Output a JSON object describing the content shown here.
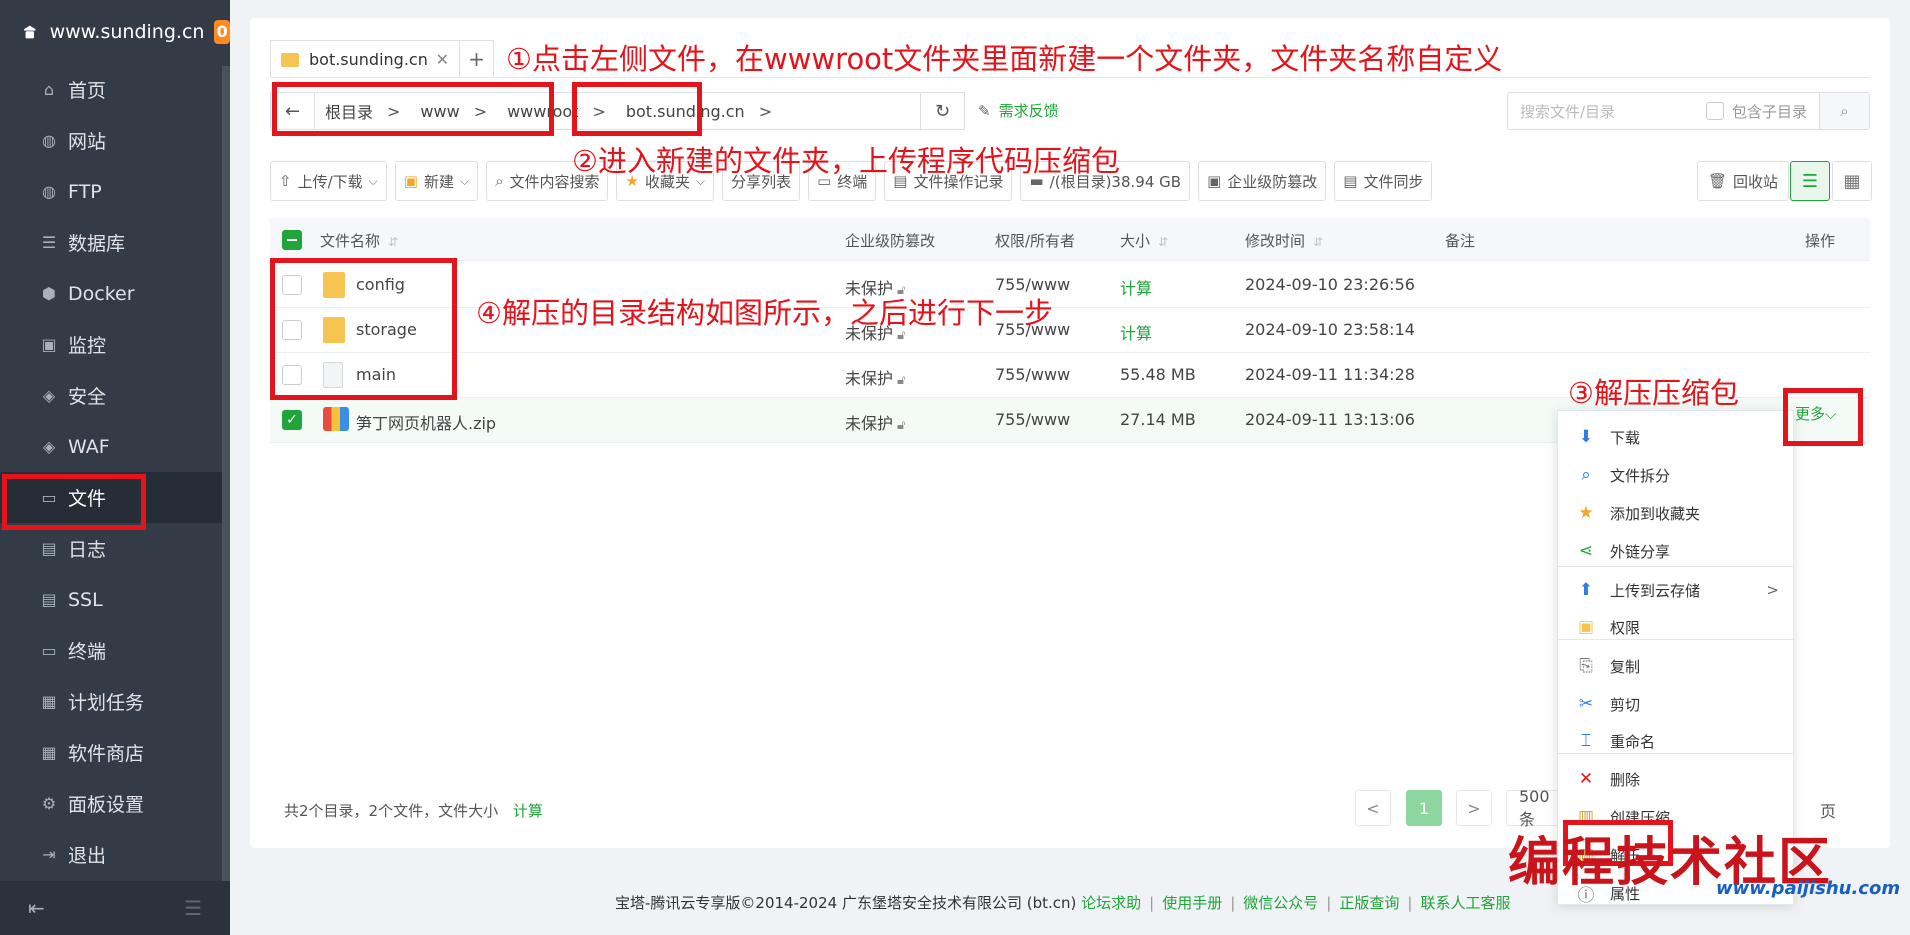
{
  "sidebar": {
    "site": "www.sunding.cn",
    "badge": "0",
    "items": [
      {
        "label": "首页",
        "icon": "home-icon",
        "glyph": "⌂"
      },
      {
        "label": "网站",
        "icon": "globe-icon",
        "glyph": "◍"
      },
      {
        "label": "FTP",
        "icon": "ftp-icon",
        "glyph": "◍"
      },
      {
        "label": "数据库",
        "icon": "database-icon",
        "glyph": "☰"
      },
      {
        "label": "Docker",
        "icon": "docker-icon",
        "glyph": "⬢"
      },
      {
        "label": "监控",
        "icon": "monitor-icon",
        "glyph": "▣"
      },
      {
        "label": "安全",
        "icon": "shield-icon",
        "glyph": "◈"
      },
      {
        "label": "WAF",
        "icon": "waf-shield-icon",
        "glyph": "◈"
      },
      {
        "label": "文件",
        "icon": "folder-icon",
        "glyph": "▭"
      },
      {
        "label": "日志",
        "icon": "log-icon",
        "glyph": "▤"
      },
      {
        "label": "SSL",
        "icon": "ssl-icon",
        "glyph": "▤"
      },
      {
        "label": "终端",
        "icon": "terminal-icon",
        "glyph": "▭"
      },
      {
        "label": "计划任务",
        "icon": "calendar-icon",
        "glyph": "▦"
      },
      {
        "label": "软件商店",
        "icon": "apps-icon",
        "glyph": "▦"
      },
      {
        "label": "面板设置",
        "icon": "gear-icon",
        "glyph": "⚙"
      },
      {
        "label": "退出",
        "icon": "logout-icon",
        "glyph": "⇥"
      }
    ],
    "active_index": 8
  },
  "tab": {
    "label": "bot.sunding.cn",
    "close": "✕",
    "add": "+"
  },
  "address": {
    "back": "←",
    "crumbs": [
      "根目录",
      "www",
      "wwwroot",
      "bot.sunding.cn"
    ],
    "sep": ">",
    "refresh": "↻"
  },
  "feedback": "需求反馈",
  "search": {
    "placeholder": "搜索文件/目录",
    "include_sub": "包含子目录"
  },
  "toolbar": {
    "upload": "上传/下载",
    "new": "新建",
    "content_search": "文件内容搜索",
    "favorites": "收藏夹",
    "share_list": "分享列表",
    "terminal": "终端",
    "op_log": "文件操作记录",
    "disk": "/(根目录)38.94 GB",
    "tamper": "企业级防篡改",
    "sync": "文件同步",
    "recycle": "回收站"
  },
  "table": {
    "headers": {
      "name": "文件名称",
      "tamper": "企业级防篡改",
      "perm": "权限/所有者",
      "size": "大小",
      "mtime": "修改时间",
      "note": "备注",
      "ops": "操作"
    },
    "rows": [
      {
        "name": "config",
        "type": "folder",
        "tamper": "未保护",
        "perm": "755/www",
        "size": "计算",
        "mtime": "2024-09-10 23:26:56",
        "selected": false
      },
      {
        "name": "storage",
        "type": "folder",
        "tamper": "未保护",
        "perm": "755/www",
        "size": "计算",
        "mtime": "2024-09-10 23:58:14",
        "selected": false
      },
      {
        "name": "main",
        "type": "file",
        "tamper": "未保护",
        "perm": "755/www",
        "size": "55.48 MB",
        "mtime": "2024-09-11 11:34:28",
        "selected": false
      },
      {
        "name": "笋丁网页机器人.zip",
        "type": "zip",
        "tamper": "未保护",
        "perm": "755/www",
        "size": "27.14 MB",
        "mtime": "2024-09-11 13:13:06",
        "selected": true
      }
    ]
  },
  "more": "更多",
  "menu": [
    {
      "label": "下载",
      "icon": "download-icon",
      "glyph": "⬇",
      "color": "#2f7de1"
    },
    {
      "label": "文件拆分",
      "icon": "magnify-icon",
      "glyph": "⌕",
      "color": "#2f7de1"
    },
    {
      "label": "添加到收藏夹",
      "icon": "star-icon",
      "glyph": "★",
      "color": "#f5a623"
    },
    {
      "label": "外链分享",
      "icon": "share-icon",
      "glyph": "⋖",
      "color": "#20a53a"
    },
    {
      "label": "上传到云存储",
      "icon": "cloud-upload-icon",
      "glyph": "⬆",
      "color": "#2f7de1"
    },
    {
      "label": "权限",
      "icon": "permission-icon",
      "glyph": "▣",
      "color": "#f5c451"
    },
    {
      "label": "复制",
      "icon": "copy-icon",
      "glyph": "⎘",
      "color": "#777777"
    },
    {
      "label": "剪切",
      "icon": "scissors-icon",
      "glyph": "✂",
      "color": "#2f7de1"
    },
    {
      "label": "重命名",
      "icon": "rename-icon",
      "glyph": "⌶",
      "color": "#2f7de1"
    },
    {
      "label": "删除",
      "icon": "delete-icon",
      "glyph": "✕",
      "color": "#e3141b"
    },
    {
      "label": "创建压缩",
      "icon": "compress-icon",
      "glyph": "▥",
      "color": "#c9a227"
    },
    {
      "label": "解压",
      "icon": "extract-icon",
      "glyph": "▥",
      "color": "#c9a227"
    },
    {
      "label": "属性",
      "icon": "info-icon",
      "glyph": "ⓘ",
      "color": "#777777"
    }
  ],
  "submenu_arrow": ">",
  "footer": {
    "summary": "共2个目录，2个文件，文件大小",
    "calc": "计算",
    "page": "1",
    "prev": "<",
    "next": ">",
    "per_page": "500条",
    "page_suffix": "页"
  },
  "copyright": {
    "text": "宝塔-腾讯云专享版©2014-2024 广东堡塔安全技术有限公司 (bt.cn)",
    "links": [
      "论坛求助",
      "使用手册",
      "微信公众号",
      "正版查询",
      "联系人工客服"
    ],
    "sep": "|"
  },
  "annotations": {
    "step1": "①点击左侧文件，在wwwroot文件夹里面新建一个文件夹，文件夹名称自定义",
    "step2": "②进入新建的文件夹，上传程序代码压缩包",
    "step3": "③解压压缩包",
    "step4": "④解压的目录结构如图所示，之后进行下一步"
  },
  "watermark": {
    "main": "编程技术社区",
    "url": "www.paijishu.com"
  }
}
